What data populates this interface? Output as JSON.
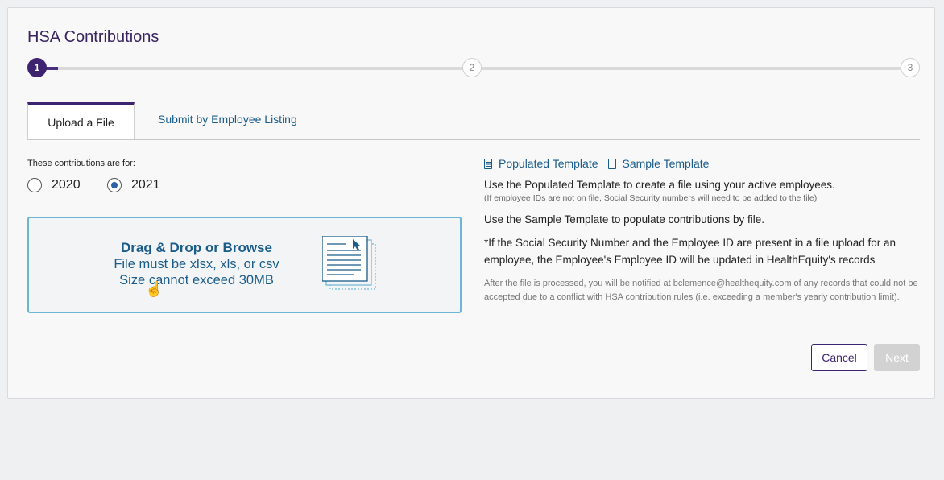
{
  "header": {
    "title": "HSA Contributions"
  },
  "stepper": {
    "steps": [
      "1",
      "2",
      "3"
    ],
    "current_step": 1
  },
  "tabs": [
    {
      "label": "Upload a File",
      "active": true
    },
    {
      "label": "Submit by Employee Listing",
      "active": false
    }
  ],
  "contributions": {
    "label": "These contributions are for:",
    "options": [
      {
        "label": "2020",
        "selected": false
      },
      {
        "label": "2021",
        "selected": true
      }
    ]
  },
  "dropzone": {
    "title": "Drag & Drop or Browse",
    "line1": "File must be xlsx, xls, or csv",
    "line2": "Size cannot exceed 30MB"
  },
  "templates": {
    "populated_label": "Populated Template",
    "sample_label": "Sample Template"
  },
  "info": {
    "p1": "Use the Populated Template to create a file using your active employees.",
    "p1_sub": "(If employee IDs are not on file, Social Security numbers will need to be added to the file)",
    "p2": "Use the Sample Template to populate contributions by file.",
    "p3": "*If the Social Security Number and the Employee ID are present in a file upload for an employee, the Employee's Employee ID will be updated in HealthEquity's records",
    "p4": "After the file is processed, you will be notified at bclemence@healthequity.com of any records that could not be accepted due to a conflict with HSA contribution rules (i.e. exceeding a member's yearly contribution limit)."
  },
  "actions": {
    "cancel_label": "Cancel",
    "next_label": "Next"
  },
  "colors": {
    "brand": "#3e2370",
    "link": "#1a5c8a",
    "dropzone_border": "#6db6d6",
    "disabled": "#d2d2d2"
  }
}
